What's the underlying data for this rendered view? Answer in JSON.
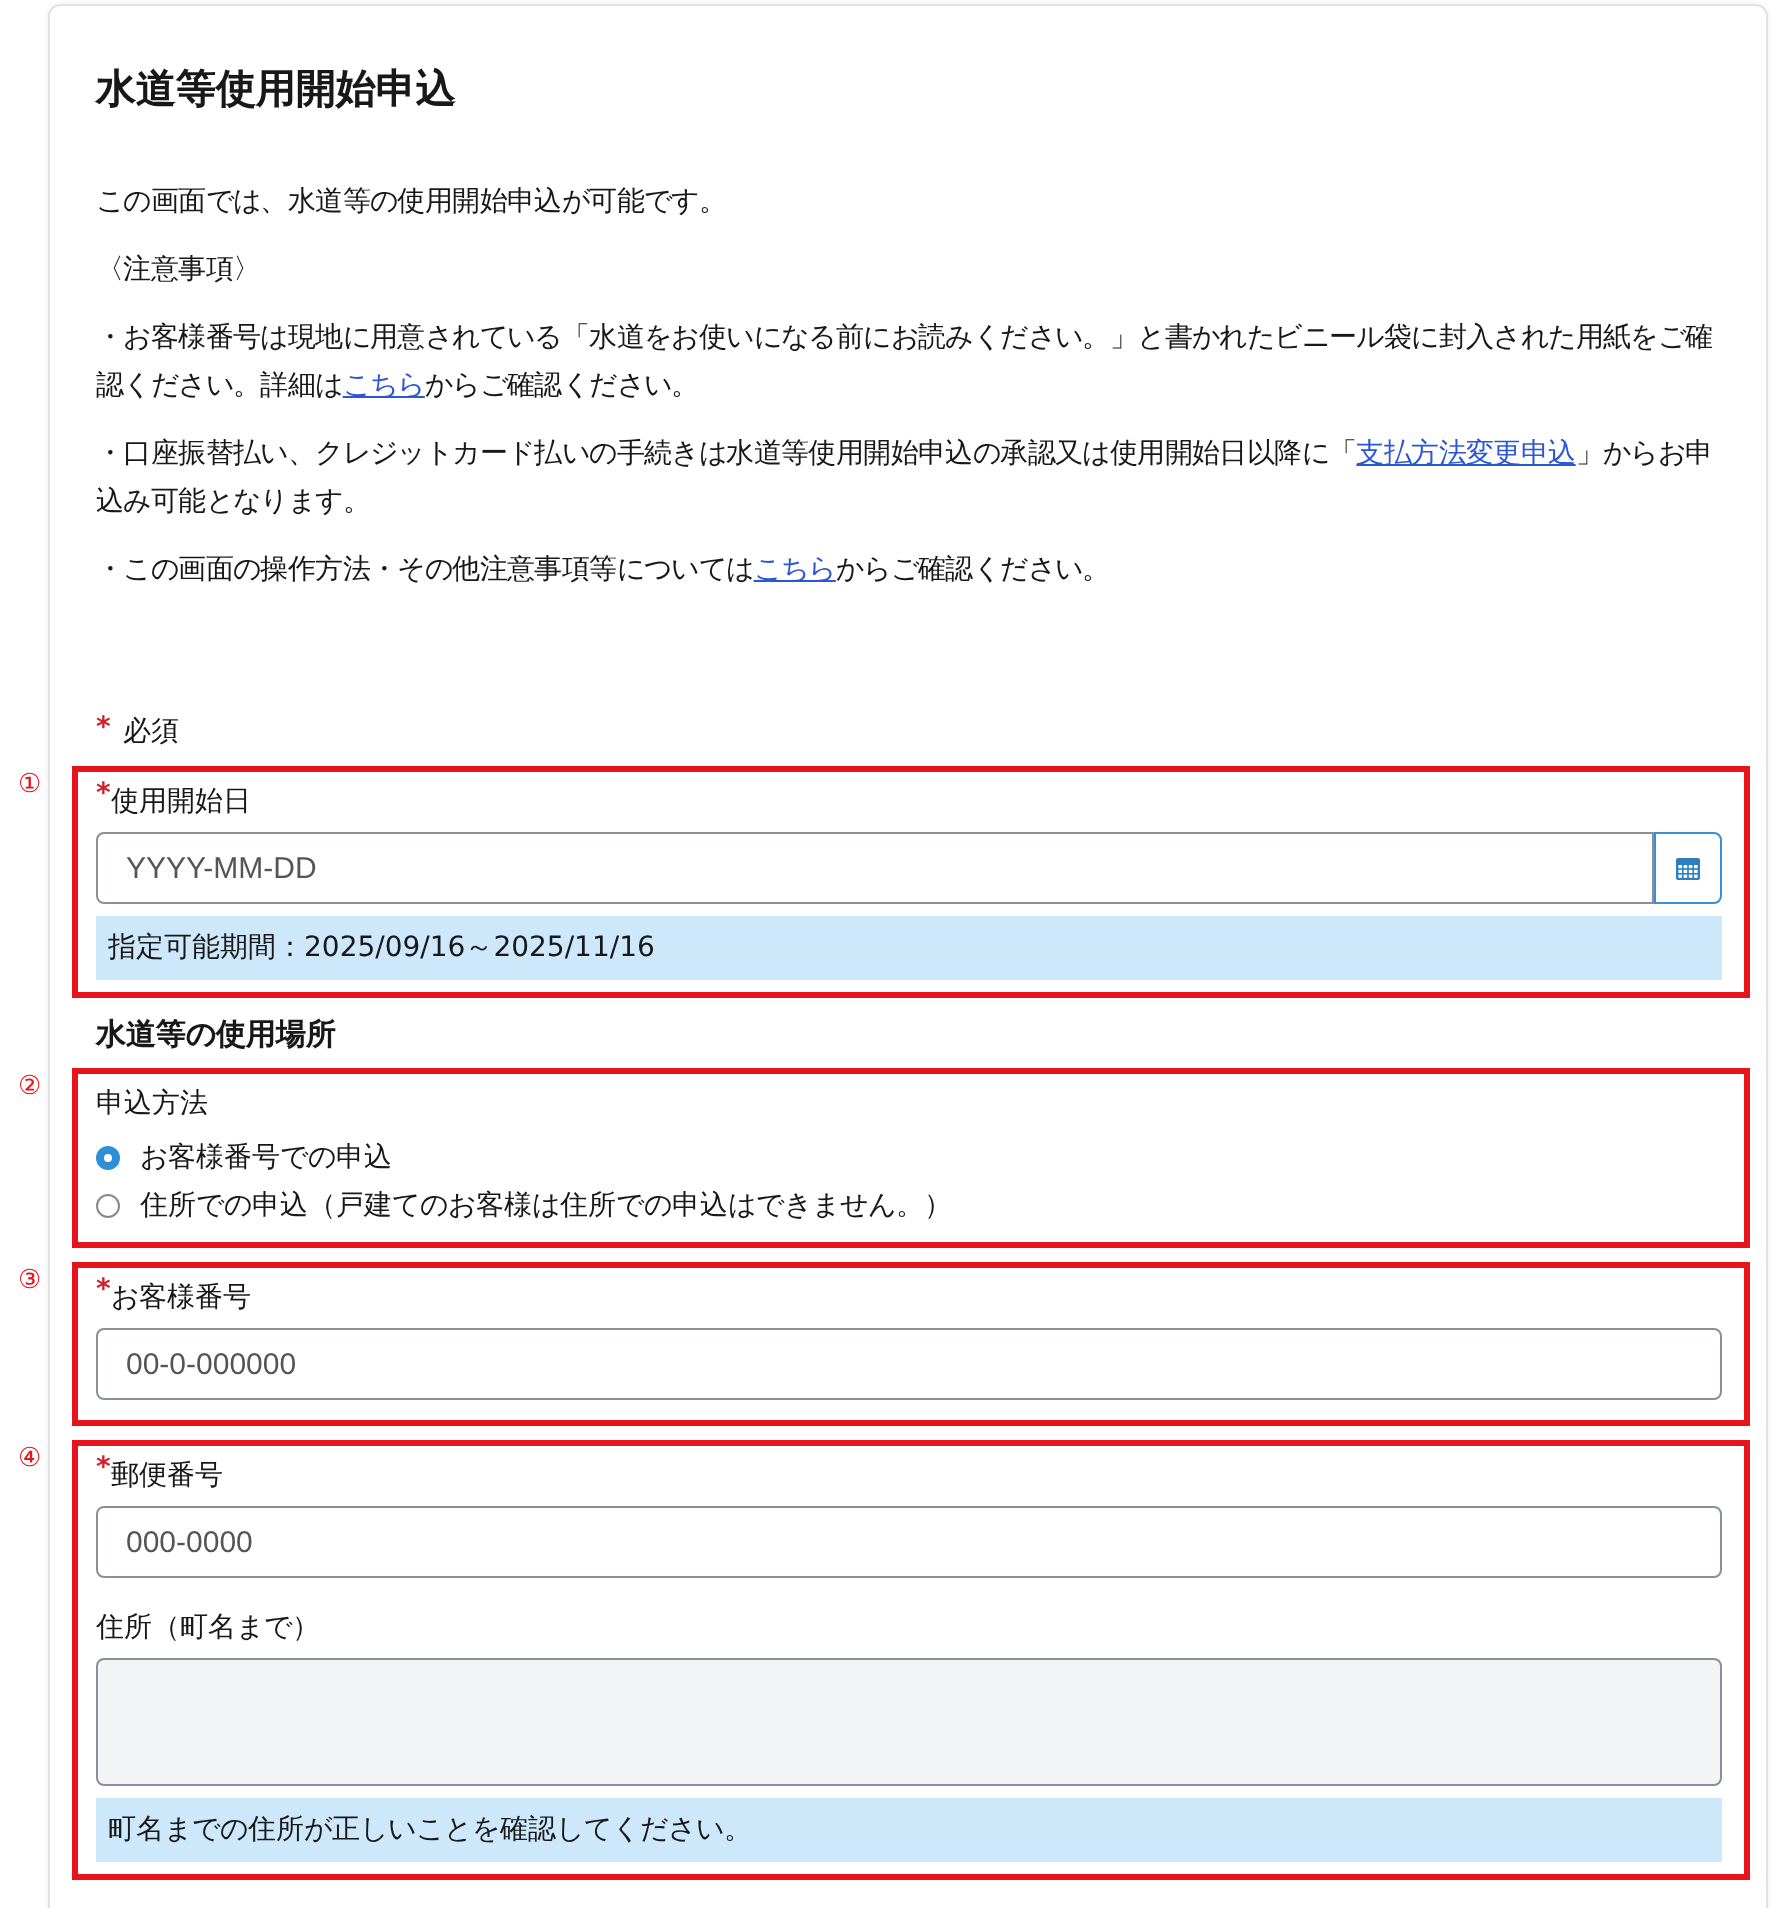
{
  "title": "水道等使用開始申込",
  "paragraphs": [
    [
      {
        "kind": "text",
        "text": "この画面では、水道等の使用開始申込が可能です。"
      }
    ],
    [
      {
        "kind": "text",
        "text": "〈注意事項〉"
      }
    ],
    [
      {
        "kind": "text",
        "text": "・お客様番号は現地に用意されている「水道をお使いになる前にお読みください。」と書かれたビニール袋に封入された用紙をご確認ください。詳細は"
      },
      {
        "kind": "link",
        "text": "こちら"
      },
      {
        "kind": "text",
        "text": "からご確認ください。"
      }
    ],
    [
      {
        "kind": "text",
        "text": "・口座振替払い、クレジットカード払いの手続きは水道等使用開始申込の承認又は使用開始日以降に「"
      },
      {
        "kind": "link",
        "text": "支払方法変更申込"
      },
      {
        "kind": "text",
        "text": "」からお申込み可能となります。"
      }
    ],
    [
      {
        "kind": "text",
        "text": "・この画面の操作方法・その他注意事項等については"
      },
      {
        "kind": "link",
        "text": "こちら"
      },
      {
        "kind": "text",
        "text": "からご確認ください。"
      }
    ]
  ],
  "required_mark": "*",
  "required_note": "必須",
  "sections": [
    {
      "kind": "group",
      "marker": "①",
      "items": [
        {
          "kind": "field",
          "label": "使用開始日",
          "required": true,
          "placeholder": "YYYY-MM-DD",
          "calendar": true
        },
        {
          "kind": "note",
          "text": "指定可能期間：2025/09/16～2025/11/16"
        }
      ]
    },
    {
      "kind": "heading",
      "text": "水道等の使用場所"
    },
    {
      "kind": "group",
      "marker": "②",
      "items": [
        {
          "kind": "radio",
          "label": "申込方法",
          "options": [
            {
              "label": "お客様番号での申込",
              "selected": true
            },
            {
              "label": "住所での申込（戸建てのお客様は住所での申込はできません。）",
              "selected": false
            }
          ]
        }
      ]
    },
    {
      "kind": "group",
      "marker": "③",
      "items": [
        {
          "kind": "field",
          "label": "お客様番号",
          "required": true,
          "placeholder": "00-0-000000",
          "calendar": false
        }
      ]
    },
    {
      "kind": "group",
      "marker": "④",
      "items": [
        {
          "kind": "field",
          "label": "郵便番号",
          "required": true,
          "placeholder": "000-0000",
          "calendar": false
        },
        {
          "kind": "textarea",
          "label": "住所（町名まで）",
          "required": false,
          "disabled": true
        },
        {
          "kind": "note",
          "text": "町名までの住所が正しいことを確認してください。"
        }
      ]
    }
  ]
}
